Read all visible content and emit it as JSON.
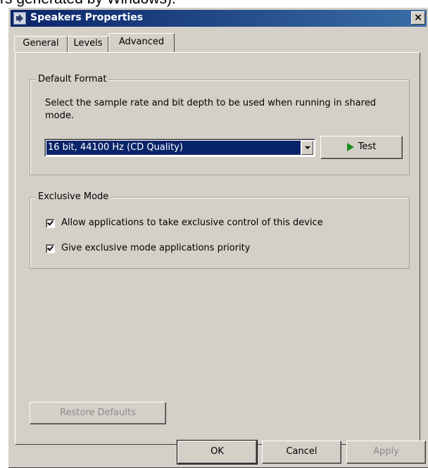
{
  "top_fragment": "rs generated by Windows).",
  "window": {
    "title": "Speakers Properties",
    "close_label": "×"
  },
  "tabs": [
    {
      "label": "General",
      "active": false
    },
    {
      "label": "Levels",
      "active": false
    },
    {
      "label": "Advanced",
      "active": true
    }
  ],
  "default_format": {
    "legend": "Default Format",
    "description_line1": "Select the sample rate and bit depth to be used when running in shared",
    "description_line2": "mode.",
    "selected_format": "16 bit, 44100 Hz (CD Quality)",
    "test_label": "Test"
  },
  "exclusive_mode": {
    "legend": "Exclusive Mode",
    "options": [
      {
        "label": "Allow applications to take exclusive control of this device",
        "checked": true
      },
      {
        "label": "Give exclusive mode applications priority",
        "checked": true
      }
    ]
  },
  "restore_defaults_label": "Restore Defaults",
  "footer": {
    "ok_label": "OK",
    "cancel_label": "Cancel",
    "apply_label": "Apply"
  },
  "colors": {
    "face": "#d4d0c8",
    "title_start": "#0a246a",
    "title_end": "#3a6ea5",
    "selection": "#0a246a",
    "play_green": "#1e8a1e"
  }
}
